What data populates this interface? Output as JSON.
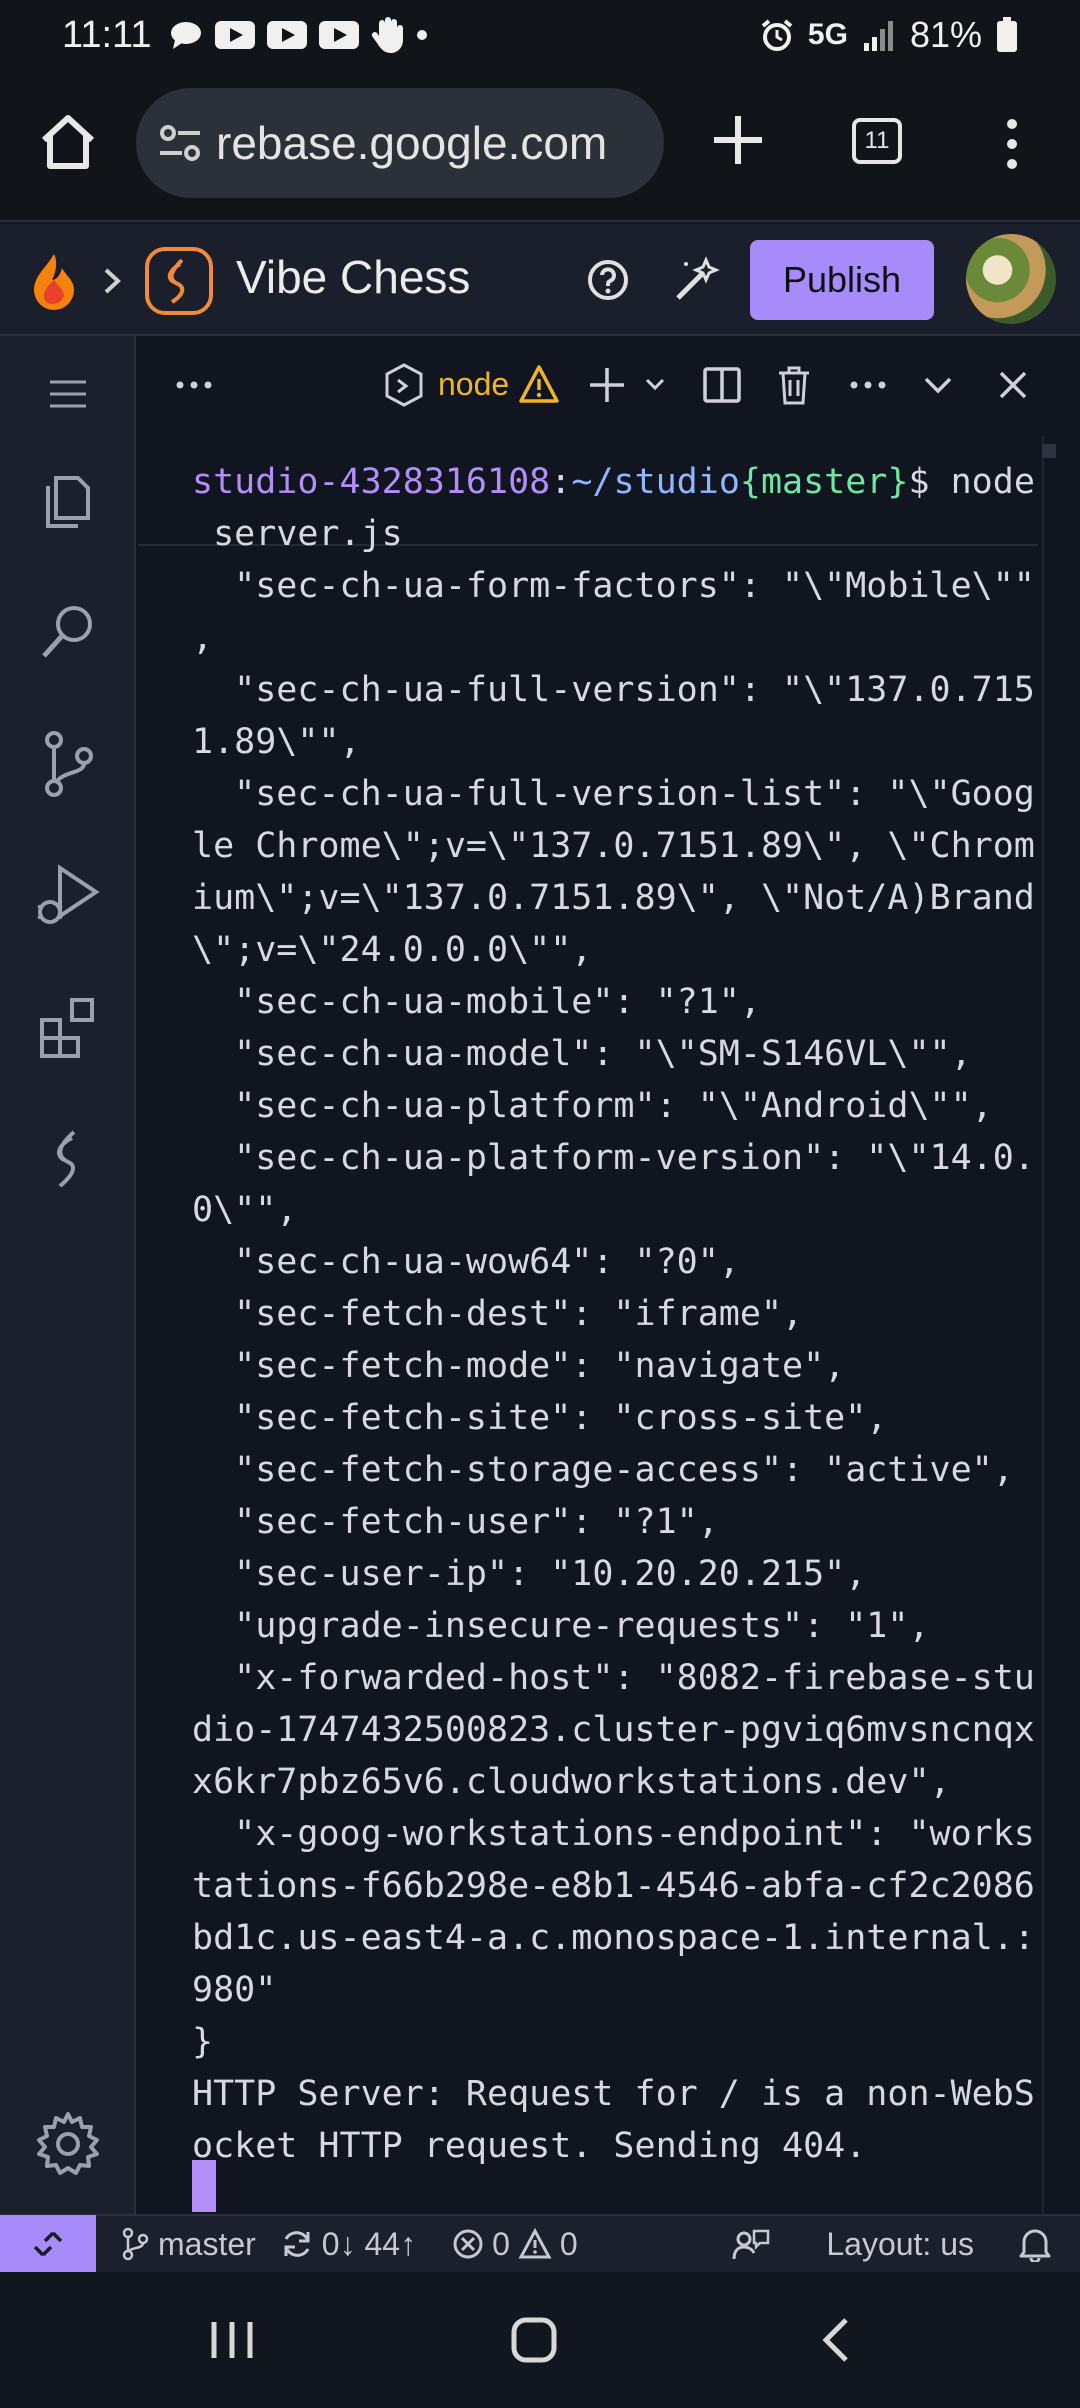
{
  "status_bar": {
    "time": "11:11",
    "network": "5G",
    "battery": "81%"
  },
  "browser": {
    "url": "rebase.google.com",
    "tab_count": "11"
  },
  "app": {
    "title": "Vibe Chess",
    "publish_label": "Publish"
  },
  "panel": {
    "terminal_name": "node"
  },
  "terminal": {
    "lines": [
      {
        "segments": [
          {
            "text": "studio-4328316108",
            "color": "#b48ef7"
          },
          {
            "text": ":",
            "color": "#d8d8e0"
          },
          {
            "text": "~/studio",
            "color": "#8fb6ff"
          },
          {
            "text": "{master}",
            "color": "#6ee7a0"
          },
          {
            "text": "$ node",
            "color": "#d8d8e0"
          }
        ]
      },
      {
        "segments": [
          {
            "text": " server.js",
            "color": "#d8d8e0"
          }
        ]
      },
      {
        "segments": [
          {
            "text": "  \"sec-ch-ua-form-factors\": \"\\\"Mobile\\\"\"",
            "color": "#d8d8e0"
          }
        ]
      },
      {
        "segments": [
          {
            "text": ",",
            "color": "#d8d8e0"
          }
        ]
      },
      {
        "segments": [
          {
            "text": "  \"sec-ch-ua-full-version\": \"\\\"137.0.715",
            "color": "#d8d8e0"
          }
        ]
      },
      {
        "segments": [
          {
            "text": "1.89\\\"\",",
            "color": "#d8d8e0"
          }
        ]
      },
      {
        "segments": [
          {
            "text": "  \"sec-ch-ua-full-version-list\": \"\\\"Goog",
            "color": "#d8d8e0"
          }
        ]
      },
      {
        "segments": [
          {
            "text": "le Chrome\\\";v=\\\"137.0.7151.89\\\", \\\"Chrom",
            "color": "#d8d8e0"
          }
        ]
      },
      {
        "segments": [
          {
            "text": "ium\\\";v=\\\"137.0.7151.89\\\", \\\"Not/A)Brand",
            "color": "#d8d8e0"
          }
        ]
      },
      {
        "segments": [
          {
            "text": "\\\";v=\\\"24.0.0.0\\\"\",",
            "color": "#d8d8e0"
          }
        ]
      },
      {
        "segments": [
          {
            "text": "  \"sec-ch-ua-mobile\": \"?1\",",
            "color": "#d8d8e0"
          }
        ]
      },
      {
        "segments": [
          {
            "text": "  \"sec-ch-ua-model\": \"\\\"SM-S146VL\\\"\",",
            "color": "#d8d8e0"
          }
        ]
      },
      {
        "segments": [
          {
            "text": "  \"sec-ch-ua-platform\": \"\\\"Android\\\"\",",
            "color": "#d8d8e0"
          }
        ]
      },
      {
        "segments": [
          {
            "text": "  \"sec-ch-ua-platform-version\": \"\\\"14.0.",
            "color": "#d8d8e0"
          }
        ]
      },
      {
        "segments": [
          {
            "text": "0\\\"\",",
            "color": "#d8d8e0"
          }
        ]
      },
      {
        "segments": [
          {
            "text": "  \"sec-ch-ua-wow64\": \"?0\",",
            "color": "#d8d8e0"
          }
        ]
      },
      {
        "segments": [
          {
            "text": "  \"sec-fetch-dest\": \"iframe\",",
            "color": "#d8d8e0"
          }
        ]
      },
      {
        "segments": [
          {
            "text": "  \"sec-fetch-mode\": \"navigate\",",
            "color": "#d8d8e0"
          }
        ]
      },
      {
        "segments": [
          {
            "text": "  \"sec-fetch-site\": \"cross-site\",",
            "color": "#d8d8e0"
          }
        ]
      },
      {
        "segments": [
          {
            "text": "  \"sec-fetch-storage-access\": \"active\",",
            "color": "#d8d8e0"
          }
        ]
      },
      {
        "segments": [
          {
            "text": "  \"sec-fetch-user\": \"?1\",",
            "color": "#d8d8e0"
          }
        ]
      },
      {
        "segments": [
          {
            "text": "  \"sec-user-ip\": \"10.20.20.215\",",
            "color": "#d8d8e0"
          }
        ]
      },
      {
        "segments": [
          {
            "text": "  \"upgrade-insecure-requests\": \"1\",",
            "color": "#d8d8e0"
          }
        ]
      },
      {
        "segments": [
          {
            "text": "  \"x-forwarded-host\": \"8082-firebase-stu",
            "color": "#d8d8e0"
          }
        ]
      },
      {
        "segments": [
          {
            "text": "dio-1747432500823.cluster-pgviq6mvsncnqx",
            "color": "#d8d8e0"
          }
        ]
      },
      {
        "segments": [
          {
            "text": "x6kr7pbz65v6.cloudworkstations.dev\",",
            "color": "#d8d8e0"
          }
        ]
      },
      {
        "segments": [
          {
            "text": "  \"x-goog-workstations-endpoint\": \"works",
            "color": "#d8d8e0"
          }
        ]
      },
      {
        "segments": [
          {
            "text": "tations-f66b298e-e8b1-4546-abfa-cf2c2086",
            "color": "#d8d8e0"
          }
        ]
      },
      {
        "segments": [
          {
            "text": "bd1c.us-east4-a.c.monospace-1.internal.:",
            "color": "#d8d8e0"
          }
        ]
      },
      {
        "segments": [
          {
            "text": "980\"",
            "color": "#d8d8e0"
          }
        ]
      },
      {
        "segments": [
          {
            "text": "}",
            "color": "#d8d8e0"
          }
        ]
      },
      {
        "segments": [
          {
            "text": "HTTP Server: Request for / is a non-WebS",
            "color": "#d8d8e0"
          }
        ]
      },
      {
        "segments": [
          {
            "text": "ocket HTTP request. Sending 404.",
            "color": "#d8d8e0"
          }
        ]
      }
    ]
  },
  "vs_status": {
    "branch": "master",
    "sync": "0↓ 44↑",
    "errors": "0",
    "warnings": "0",
    "layout": "Layout: us"
  },
  "colors": {
    "accent": "#a78bfa",
    "warning": "#f0b429",
    "terminal_bg": "#111520"
  }
}
